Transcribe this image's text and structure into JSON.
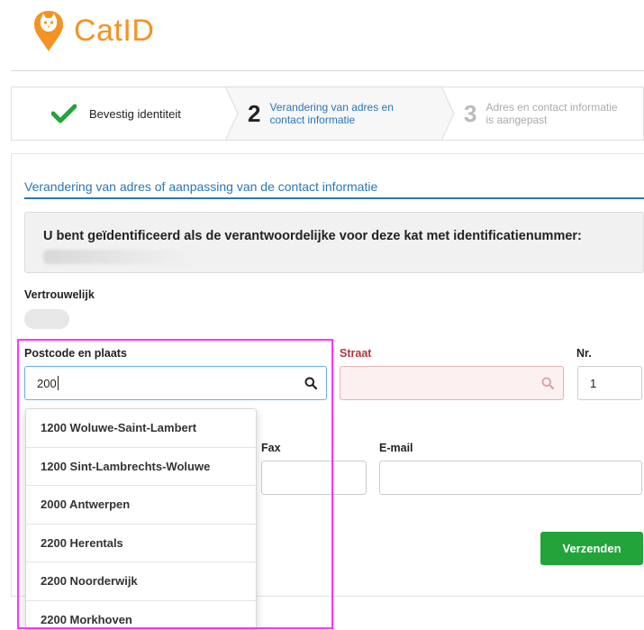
{
  "brand": {
    "name": "CatID",
    "color": "#f39323"
  },
  "stepper": {
    "steps": [
      {
        "label": "Bevestig identiteit",
        "icon": "check-icon",
        "state": "done"
      },
      {
        "number": "2",
        "label_line1": "Verandering van adres en",
        "label_line2": "contact informatie",
        "state": "active"
      },
      {
        "number": "3",
        "label_line1": "Adres en contact informatie",
        "label_line2": "is aangepast",
        "state": "pending"
      }
    ]
  },
  "form": {
    "section_title": "Verandering van adres of aanpassing van de contact informatie",
    "info_text": "U bent geïdentificeerd als de verantwoordelijke voor deze kat met identificatienummer:",
    "confidential_label": "Vertrouwelijk",
    "postcode_label": "Postcode en plaats",
    "postcode_value": "200",
    "street_label": "Straat",
    "street_value": "",
    "nr_label": "Nr.",
    "nr_value": "1",
    "fax_label": "Fax",
    "fax_value": "",
    "email_label": "E-mail",
    "email_value": "",
    "submit_label": "Verzenden"
  },
  "suggestions": [
    "1200 Woluwe-Saint-Lambert",
    "1200 Sint-Lambrechts-Woluwe",
    "2000 Antwerpen",
    "2200 Herentals",
    "2200 Noorderwijk",
    "2200 Morkhoven"
  ],
  "colors": {
    "accent": "#2a76b8",
    "success": "#22a43a",
    "error": "#b5343a",
    "highlight": "#ff33ff"
  }
}
